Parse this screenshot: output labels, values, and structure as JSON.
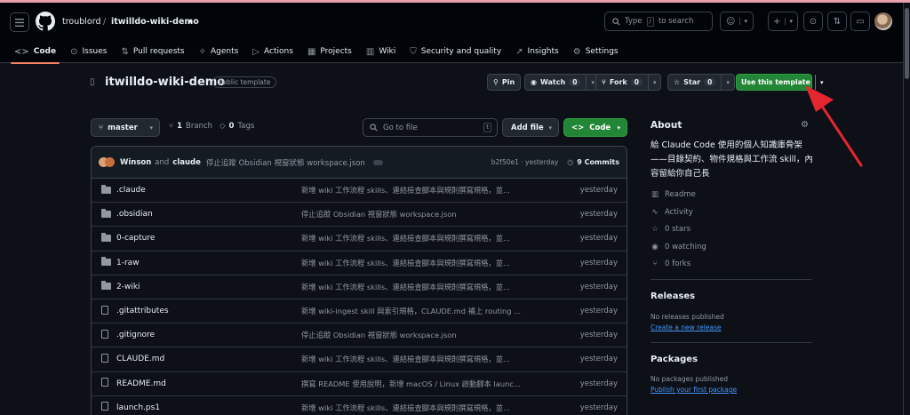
{
  "header": {
    "owner": "troublord",
    "separator": "/",
    "repo": "itwilldo-wiki-demo",
    "search_placeholder": "Type",
    "search_key": "/",
    "search_suffix": "to search"
  },
  "tabs": [
    {
      "label": "Code",
      "icon": "code-icon"
    },
    {
      "label": "Issues",
      "icon": "issue-icon"
    },
    {
      "label": "Pull requests",
      "icon": "pull-request-icon"
    },
    {
      "label": "Agents",
      "icon": "agents-icon"
    },
    {
      "label": "Actions",
      "icon": "play-icon"
    },
    {
      "label": "Projects",
      "icon": "table-icon"
    },
    {
      "label": "Wiki",
      "icon": "book-icon"
    },
    {
      "label": "Security and quality",
      "icon": "shield-icon"
    },
    {
      "label": "Insights",
      "icon": "graph-icon"
    },
    {
      "label": "Settings",
      "icon": "gear-icon"
    }
  ],
  "repo_header": {
    "title": "itwilldo-wiki-demo",
    "badge": "Public template",
    "pin": "Pin",
    "watch": "Watch",
    "watch_count": "0",
    "fork": "Fork",
    "fork_count": "0",
    "star": "Star",
    "star_count": "0",
    "use_template": "Use this template"
  },
  "toolbar": {
    "branch": "master",
    "branch_count": "1",
    "branch_label": "Branch",
    "tags_count": "0",
    "tags_label": "Tags",
    "goto_placeholder": "Go to file",
    "goto_key": "t",
    "add_file": "Add file",
    "code": "Code"
  },
  "commit": {
    "author1": "Winson",
    "and": "and",
    "author2": "claude",
    "message": "停止追蹤 Obsidian 視窗狀態 workspace.json",
    "sha": "b2f50e1 · yesterday",
    "commits": "9 Commits"
  },
  "files": [
    {
      "name": ".claude",
      "type": "folder",
      "message": "新增 wiki 工作流程 skills、連結檢查腳本與規則撰寫規格，並...",
      "date": "yesterday"
    },
    {
      "name": ".obsidian",
      "type": "folder",
      "message": "停止追蹤 Obsidian 視窗狀態 workspace.json",
      "date": "yesterday"
    },
    {
      "name": "0-capture",
      "type": "folder",
      "message": "新增 wiki 工作流程 skills、連結檢查腳本與規則撰寫規格，並...",
      "date": "yesterday"
    },
    {
      "name": "1-raw",
      "type": "folder",
      "message": "新增 wiki 工作流程 skills、連結檢查腳本與規則撰寫規格，並...",
      "date": "yesterday"
    },
    {
      "name": "2-wiki",
      "type": "folder",
      "message": "新增 wiki 工作流程 skills、連結檢查腳本與規則撰寫規格，並...",
      "date": "yesterday"
    },
    {
      "name": ".gitattributes",
      "type": "file",
      "message": "新增 wiki-ingest skill 與索引規格，CLAUDE.md 補上 routing ...",
      "date": "yesterday"
    },
    {
      "name": ".gitignore",
      "type": "file",
      "message": "停止追蹤 Obsidian 視窗狀態 workspace.json",
      "date": "yesterday"
    },
    {
      "name": "CLAUDE.md",
      "type": "file",
      "message": "新增 wiki 工作流程 skills、連結檢查腳本與規則撰寫規格，並...",
      "date": "yesterday"
    },
    {
      "name": "README.md",
      "type": "file",
      "message": "撰寫 README 使用說明，新增 macOS / Linux 啟動腳本 launc...",
      "date": "yesterday"
    },
    {
      "name": "launch.ps1",
      "type": "file",
      "message": "新增 wiki 工作流程 skills、連結檢查腳本與規則撰寫規格，並...",
      "date": "yesterday"
    }
  ],
  "about": {
    "title": "About",
    "description": "給 Claude Code 使用的個人知識庫骨架——目錄契約、物件規格與工作流 skill，內容留給你自己長",
    "readme": "Readme",
    "activity": "Activity",
    "stars": "0 stars",
    "watching": "0 watching",
    "forks": "0 forks"
  },
  "releases": {
    "title": "Releases",
    "none": "No releases published",
    "link": "Create a new release"
  },
  "packages": {
    "title": "Packages",
    "none": "No packages published",
    "link": "Publish your first package"
  },
  "colors": {
    "accent_green": "#238636",
    "annotation_arrow": "#e5262e",
    "tab_underline": "#f78166"
  }
}
